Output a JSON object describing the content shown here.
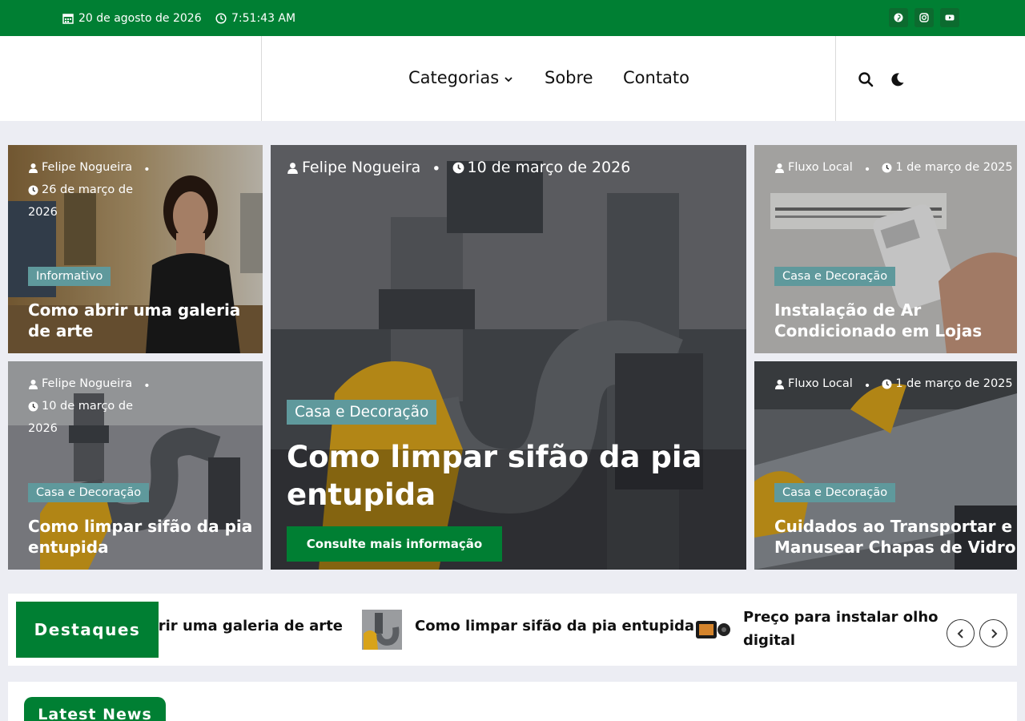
{
  "topbar": {
    "date": "20 de agosto de 2026",
    "time": "7:51:43 AM",
    "socials": [
      "pinterest-icon",
      "instagram-icon",
      "youtube-icon"
    ]
  },
  "nav": {
    "items": [
      {
        "label": "Categorias",
        "has_dropdown": true
      },
      {
        "label": "Sobre"
      },
      {
        "label": "Contato"
      }
    ],
    "actions": [
      "search-icon",
      "moon-icon"
    ]
  },
  "cards": [
    {
      "author": "Felipe Nogueira",
      "date_line1": "26 de março de",
      "date_line2": "2026",
      "category": "Informativo",
      "title_line1": "Como abrir uma galeria",
      "title_line2": "de arte"
    },
    {
      "author": "Felipe Nogueira",
      "date_line1": "10 de março de",
      "date_line2": "2026",
      "category": "Casa e Decoração",
      "title_line1": "Como limpar sifão da pia",
      "title_line2": "entupida"
    },
    {
      "author": "Felipe Nogueira",
      "date": "10 de março de 2026",
      "category": "Casa e Decoração",
      "title_line1": "Como limpar sifão da pia",
      "title_line2": "entupida",
      "button": "Consulte mais informação"
    },
    {
      "author": "Fluxo Local",
      "date": "1 de março de 2025",
      "category": "Casa e Decoração",
      "title_line1": "Instalação de Ar",
      "title_line2": "Condicionado em Lojas"
    },
    {
      "author": "Fluxo Local",
      "date": "1 de março de 2025",
      "category": "Casa e Decoração",
      "title_line1": "Cuidados ao Transportar e",
      "title_line2": "Manusear Chapas de Vidro"
    }
  ],
  "ticker": {
    "label": "Destaques",
    "items": [
      {
        "text": "Como abrir uma galeria de arte"
      },
      {
        "text": "Como limpar sifão da pia entupida"
      },
      {
        "text_line1": "Preço para instalar olho mágico",
        "text_line2": "digital"
      }
    ]
  },
  "latest": {
    "label": "Latest News"
  },
  "colors": {
    "brand_green": "#007f33",
    "badge_teal": "#5f999c",
    "page_bg": "#ecedf3"
  }
}
